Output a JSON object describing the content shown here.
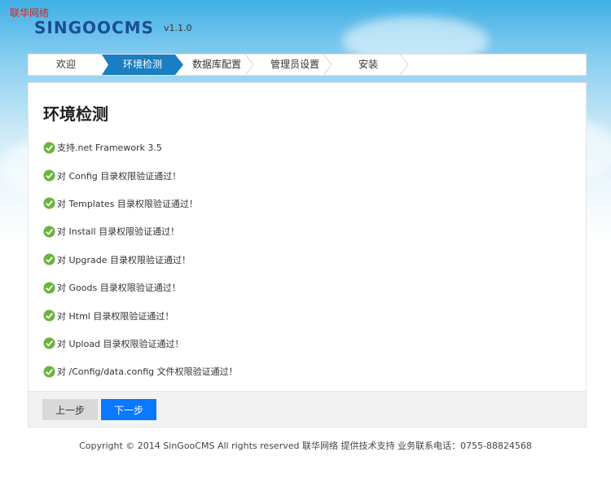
{
  "corner_label": "联华网络",
  "header": {
    "logo_text": "SINGOOCMS",
    "version": "v1.1.0"
  },
  "steps": [
    {
      "label": "欢迎",
      "active": false
    },
    {
      "label": "环境检测",
      "active": true
    },
    {
      "label": "数据库配置",
      "active": false
    },
    {
      "label": "管理员设置",
      "active": false
    },
    {
      "label": "安装",
      "active": false
    }
  ],
  "main": {
    "title": "环境检测",
    "checks": [
      "支持.net Framework 3.5",
      "对 Config 目录权限验证通过！",
      "对 Templates 目录权限验证通过！",
      "对 Install 目录权限验证通过！",
      "对 Upgrade 目录权限验证通过！",
      "对 Goods 目录权限验证通过！",
      "对 Html 目录权限验证通过！",
      "对 Upload 目录权限验证通过！",
      "对 /Config/data.config 文件权限验证通过！"
    ]
  },
  "buttons": {
    "prev": "上一步",
    "next": "下一步"
  },
  "footer": {
    "copyright": "Copyright © 2014 SinGooCMS All rights reserved 联华网络 提供技术支持 业务联系电话：0755-88824568"
  },
  "colors": {
    "accent": "#1a7ec3",
    "next_button": "#0a78ff",
    "check_green": "#6cb33e"
  },
  "icons": {
    "check": "check-circle-icon"
  }
}
